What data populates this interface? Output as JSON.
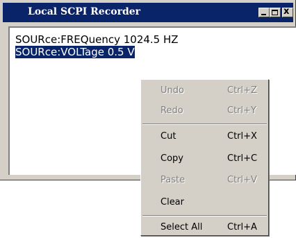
{
  "window": {
    "title": "Local SCPI Recorder",
    "controls": [
      "minimize-icon",
      "maximize-icon",
      "close-icon"
    ],
    "close_glyph": "x"
  },
  "editor": {
    "lines": [
      {
        "text": "SOURce:FREQuency 1024.5 HZ",
        "selected": false
      },
      {
        "text": "SOURce:VOLTage 0.5 V",
        "selected": true
      }
    ]
  },
  "context_menu": {
    "undo": {
      "label": "Undo",
      "shortcut": "Ctrl+Z",
      "enabled": false
    },
    "redo": {
      "label": "Redo",
      "shortcut": "Ctrl+Y",
      "enabled": false
    },
    "cut": {
      "label": "Cut",
      "shortcut": "Ctrl+X",
      "enabled": true
    },
    "copy": {
      "label": "Copy",
      "shortcut": "Ctrl+C",
      "enabled": true
    },
    "paste": {
      "label": "Paste",
      "shortcut": "Ctrl+V",
      "enabled": false
    },
    "clear": {
      "label": "Clear",
      "shortcut": "",
      "enabled": true
    },
    "select_all": {
      "label": "Select All",
      "shortcut": "Ctrl+A",
      "enabled": true
    }
  },
  "colors": {
    "titlebar": "#0a246a",
    "selection": "#0a246a",
    "face": "#d4d0c8",
    "disabled_text": "#808080"
  }
}
